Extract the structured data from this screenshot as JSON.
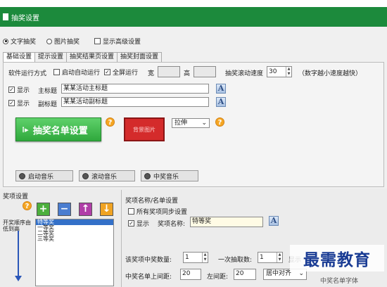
{
  "window": {
    "title": "抽奖设置"
  },
  "mode": {
    "text_draw": "文字抽奖",
    "image_draw": "图片抽奖",
    "show_advanced": "显示高级设置",
    "selected": "text_draw"
  },
  "tabs": [
    "基础设置",
    "提示设置",
    "抽奖结果页设置",
    "抽奖封面设置"
  ],
  "run": {
    "label": "软件运行方式",
    "autorun": "启动自动运行",
    "autorun_checked": false,
    "fullscreen": "全屏运行",
    "fullscreen_checked": true,
    "width_label": "宽",
    "width_value": "",
    "height_label": "高",
    "height_value": "",
    "speed_label": "抽奖滚动速度",
    "speed_value": "30",
    "speed_hint": "（数字越小速度越快）"
  },
  "main_title": {
    "show": "显示",
    "checked": true,
    "label": "主标题",
    "value": "某某活动主标题",
    "font_btn": "A"
  },
  "sub_title": {
    "show": "显示",
    "checked": true,
    "label": "副标题",
    "value": "某某活动副标题",
    "font_btn": "A"
  },
  "list_button": {
    "label": "抽奖名单设置",
    "help": "?"
  },
  "bg": {
    "label": "背景图片",
    "stretch": "拉伸",
    "help": "?"
  },
  "music": {
    "start": "启动音乐",
    "scroll": "滚动音乐",
    "win": "中奖音乐"
  },
  "prize_panel": {
    "title": "奖项设置",
    "help": "?",
    "add": "+",
    "remove": "−",
    "up": "↑",
    "down": "↓",
    "order_label": "开奖顺序由低到高",
    "items": [
      "特等奖",
      "一等奖",
      "二等奖",
      "三等奖"
    ],
    "selected_index": 0
  },
  "prize_detail": {
    "title": "奖项名称/名单设置",
    "sync_all": "所有奖项同步设置",
    "sync_checked": false,
    "show": "显示",
    "show_checked": true,
    "name_label": "奖项名称:",
    "name_value": "特等奖",
    "font_btn": "A",
    "count_label": "该奖项中奖数量:",
    "count_value": "1",
    "per_draw_label": "一次抽取数:",
    "per_draw_value": "1",
    "display_label": "显示",
    "top_margin_label": "中奖名单上间距:",
    "top_margin_value": "20",
    "left_margin_label": "左间距:",
    "left_margin_value": "20",
    "align_value": "居中对齐",
    "partial_label": "中奖名单字体"
  },
  "watermark": "最需教育",
  "colors": {
    "titlebar": "#1c8a3c",
    "green_button": "#34ab41",
    "red_button": "#d42b2b",
    "list_selected": "#3370c8"
  }
}
